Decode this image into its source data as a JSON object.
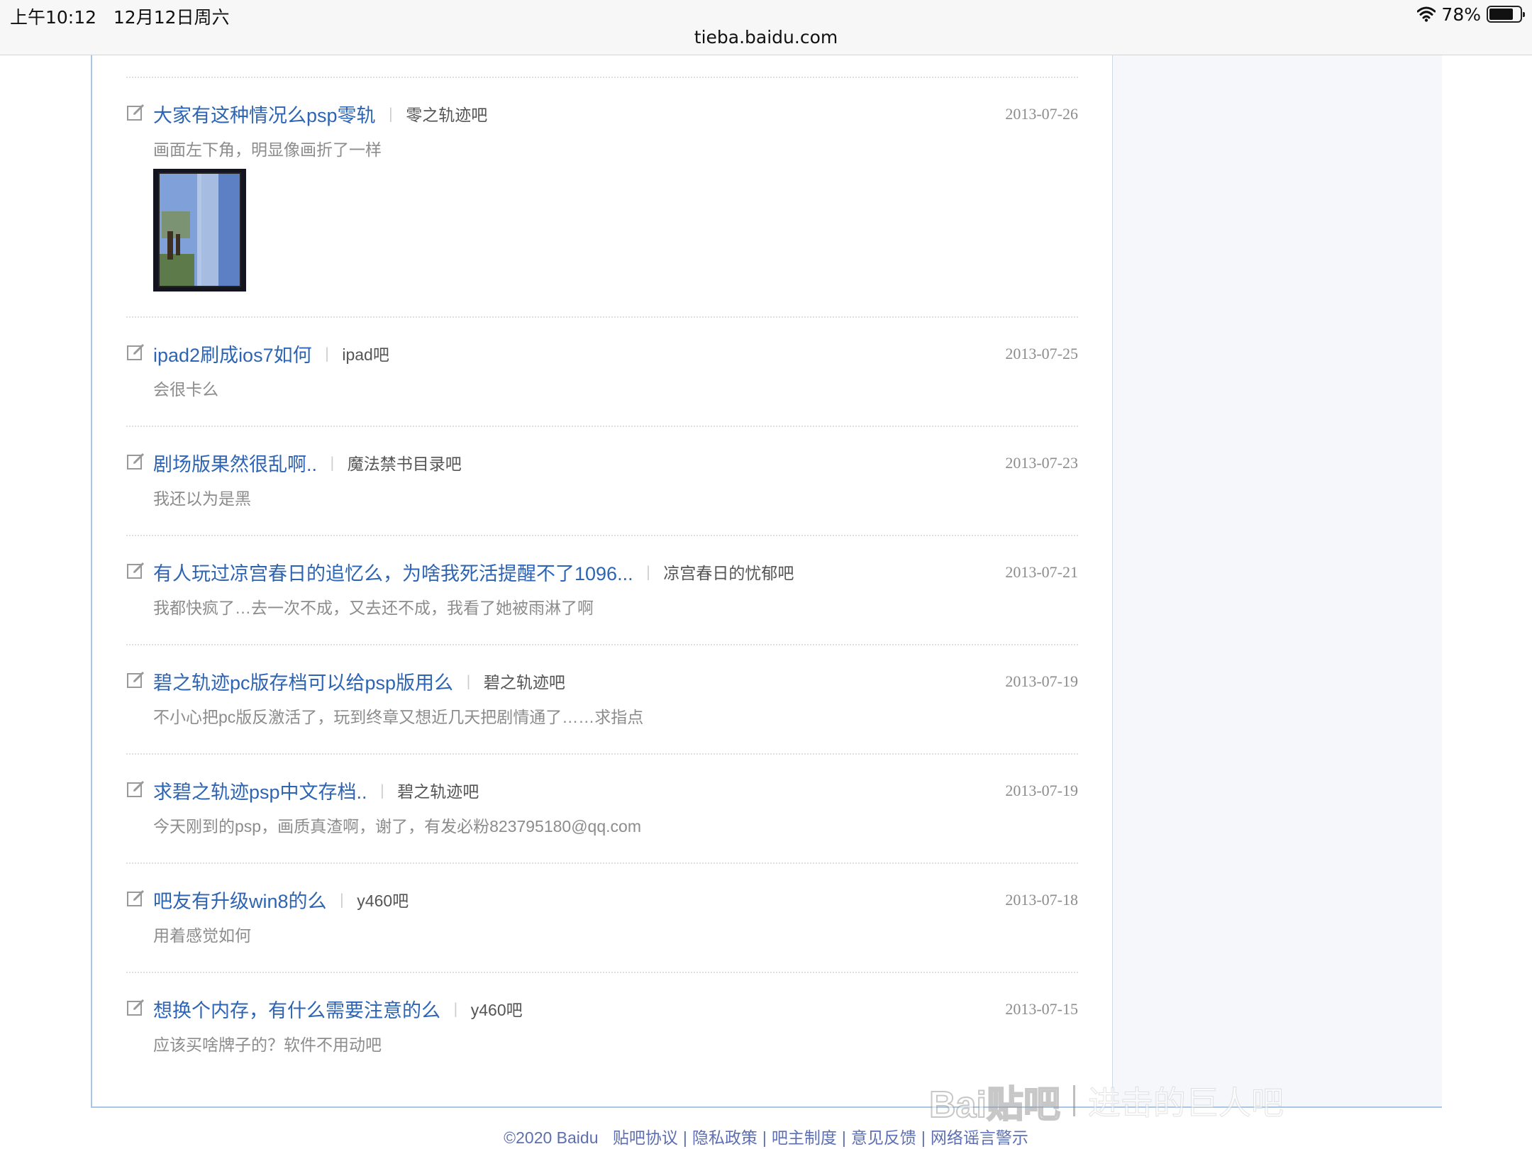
{
  "status_bar": {
    "time": "上午10:12   12月12日周六",
    "battery": "78%",
    "battery_level": 0.78
  },
  "address_bar": {
    "url": "tieba.baidu.com"
  },
  "posts": [
    {
      "title": "大家有这种情况么psp零轨",
      "forum": "零之轨迹吧",
      "date": "2013-07-26",
      "desc": "画面左下角，明显像画折了一样",
      "has_image": true
    },
    {
      "title": "ipad2刷成ios7如何",
      "forum": "ipad吧",
      "date": "2013-07-25",
      "desc": "会很卡么"
    },
    {
      "title": "剧场版果然很乱啊..",
      "forum": "魔法禁书目录吧",
      "date": "2013-07-23",
      "desc": "我还以为是黑"
    },
    {
      "title": "有人玩过凉宫春日的追忆么，为啥我死活提醒不了1096...",
      "forum": "凉宫春日的忧郁吧",
      "date": "2013-07-21",
      "desc": "我都快疯了…去一次不成，又去还不成，我看了她被雨淋了啊"
    },
    {
      "title": "碧之轨迹pc版存档可以给psp版用么",
      "forum": "碧之轨迹吧",
      "date": "2013-07-19",
      "desc": "不小心把pc版反激活了，玩到终章又想近几天把剧情通了……求指点"
    },
    {
      "title": "求碧之轨迹psp中文存档..",
      "forum": "碧之轨迹吧",
      "date": "2013-07-19",
      "desc": "今天刚到的psp，画质真渣啊，谢了，有发必粉823795180@qq.com"
    },
    {
      "title": "吧友有升级win8的么",
      "forum": "y460吧",
      "date": "2013-07-18",
      "desc": "用着感觉如何"
    },
    {
      "title": "想换个内存，有什么需要注意的么",
      "forum": "y460吧",
      "date": "2013-07-15",
      "desc": "应该买啥牌子的？软件不用动吧"
    }
  ],
  "footer": {
    "copyright": "©2020 Baidu",
    "links": [
      "贴吧协议",
      "隐私政策",
      "吧主制度",
      "意见反馈",
      "网络谣言警示"
    ]
  },
  "watermark": {
    "logo": "Bai贴吧",
    "text": "进击的巨人吧"
  },
  "colors": {
    "link": "#2d64b3",
    "meta": "#8c8c8c",
    "frame": "#a9c6e2",
    "footer": "#5d6fb0"
  }
}
